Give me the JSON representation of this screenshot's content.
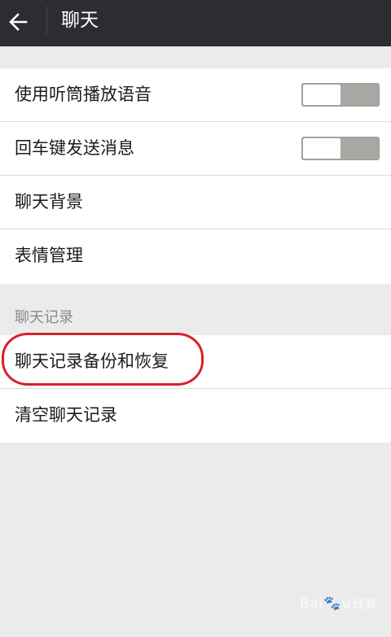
{
  "header": {
    "title": "聊天",
    "back_icon": "arrow-left-icon"
  },
  "settings": [
    {
      "label": "使用听筒播放语音",
      "toggle": false
    },
    {
      "label": "回车键发送消息",
      "toggle": false
    },
    {
      "label": "聊天背景"
    },
    {
      "label": "表情管理"
    }
  ],
  "chat_records": {
    "section_title": "聊天记录",
    "items": [
      {
        "label": "聊天记录备份和恢复"
      },
      {
        "label": "清空聊天记录"
      }
    ]
  },
  "watermark": {
    "brand": "Bai",
    "brand_tail": "u",
    "sub": "经验"
  },
  "colors": {
    "titlebar": "#2b2d30",
    "background": "#ebebeb",
    "highlight": "#d8202a",
    "toggle_off": "#a6a8a3"
  }
}
